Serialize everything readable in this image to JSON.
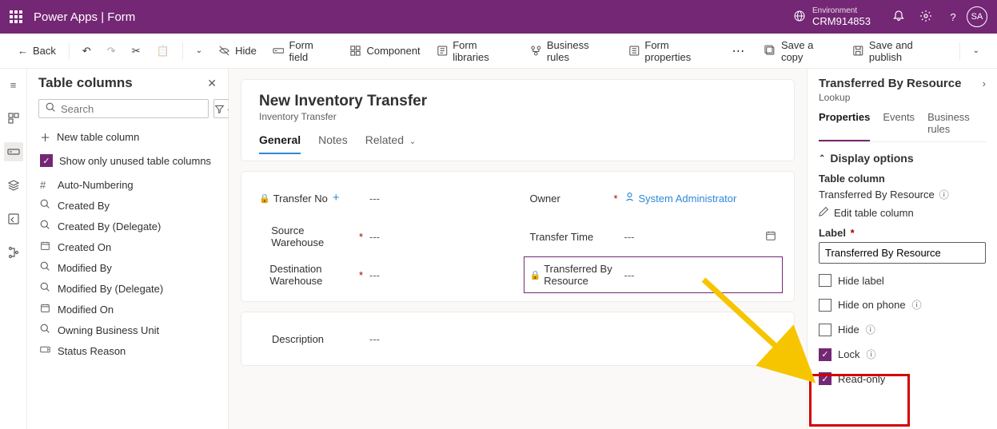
{
  "header": {
    "app_title": "Power Apps  |  Form",
    "env_label": "Environment",
    "env_name": "CRM914853",
    "avatar": "SA"
  },
  "cmdbar": {
    "back": "Back",
    "hide": "Hide",
    "form_field": "Form field",
    "component": "Component",
    "form_libraries": "Form libraries",
    "business_rules": "Business rules",
    "form_properties": "Form properties",
    "save_copy": "Save a copy",
    "save_publish": "Save and publish"
  },
  "cols_panel": {
    "title": "Table columns",
    "search_placeholder": "Search",
    "new_col": "New table column",
    "show_unused": "Show only unused table columns",
    "items": [
      {
        "icon": "#",
        "label": "Auto-Numbering"
      },
      {
        "icon": "search",
        "label": "Created By"
      },
      {
        "icon": "search",
        "label": "Created By (Delegate)"
      },
      {
        "icon": "cal",
        "label": "Created On"
      },
      {
        "icon": "search",
        "label": "Modified By"
      },
      {
        "icon": "search",
        "label": "Modified By (Delegate)"
      },
      {
        "icon": "cal",
        "label": "Modified On"
      },
      {
        "icon": "search",
        "label": "Owning Business Unit"
      },
      {
        "icon": "opt",
        "label": "Status Reason"
      }
    ]
  },
  "form": {
    "title": "New Inventory Transfer",
    "subtitle": "Inventory Transfer",
    "tabs": {
      "general": "General",
      "notes": "Notes",
      "related": "Related"
    },
    "fields": {
      "transfer_no": {
        "label": "Transfer No",
        "value": "---"
      },
      "source_wh": {
        "label": "Source Warehouse",
        "value": "---"
      },
      "dest_wh": {
        "label": "Destination Warehouse",
        "value": "---"
      },
      "owner": {
        "label": "Owner",
        "value": "System Administrator"
      },
      "transfer_time": {
        "label": "Transfer Time",
        "value": "---"
      },
      "trans_by": {
        "label": "Transferred By Resource",
        "value": "---"
      },
      "description": {
        "label": "Description",
        "value": "---"
      }
    }
  },
  "props": {
    "title": "Transferred By Resource",
    "subtitle": "Lookup",
    "tabs": {
      "properties": "Properties",
      "events": "Events",
      "rules": "Business rules"
    },
    "display_options": "Display options",
    "table_column_lbl": "Table column",
    "table_column_val": "Transferred By Resource",
    "edit": "Edit table column",
    "label_lbl": "Label",
    "label_val": "Transferred By Resource",
    "hide_label": "Hide label",
    "hide_phone": "Hide on phone",
    "hide": "Hide",
    "lock": "Lock",
    "readonly": "Read-only"
  }
}
